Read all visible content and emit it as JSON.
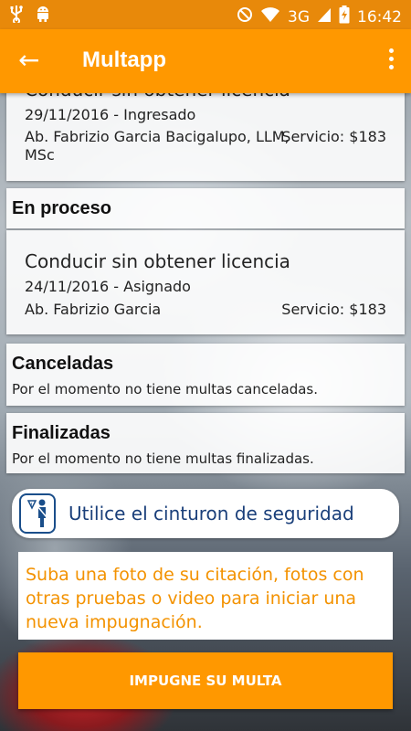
{
  "status_bar": {
    "left_icons": [
      "usb-icon",
      "android-icon"
    ],
    "right_icons": [
      "do-not-disturb-icon",
      "wifi-icon",
      "battery-charging-icon"
    ],
    "network": "3G",
    "time": "16:42"
  },
  "toolbar": {
    "back_icon": "←",
    "title": "Multapp",
    "menu_icon": "more-vert-icon"
  },
  "ingresado_card": {
    "name": "Conducir sin obtener licencia",
    "date_status": "29/11/2016 - Ingresado",
    "lawyer": "Ab. Fabrizio Garcia Bacigalupo, LLM,",
    "lawyer_cont": "MSc",
    "price": "Servicio: $183"
  },
  "en_proceso": {
    "header": "En proceso",
    "card": {
      "name": "Conducir sin obtener licencia",
      "date_status": "24/11/2016 - Asignado",
      "lawyer": "Ab. Fabrizio Garcia",
      "price": "Servicio: $183"
    }
  },
  "canceladas": {
    "header": "Canceladas",
    "message": "Por el momento no tiene multas canceladas."
  },
  "finalizadas": {
    "header": "Finalizadas",
    "message": "Por el momento no tiene multas finalizadas."
  },
  "tip": {
    "icon": "seatbelt-person-icon",
    "text": "Utilice el cinturon de seguridad"
  },
  "promo": {
    "text": "Suba una foto de su citación, fotos con otras pruebas o video para iniciar una nueva impugnación."
  },
  "cta": {
    "label": "IMPUGNE SU MULTA"
  },
  "colors": {
    "accent": "#ff9800",
    "status_bar": "#e8890a",
    "promo_text": "#f39200",
    "tip_text": "#1a3f7a"
  }
}
